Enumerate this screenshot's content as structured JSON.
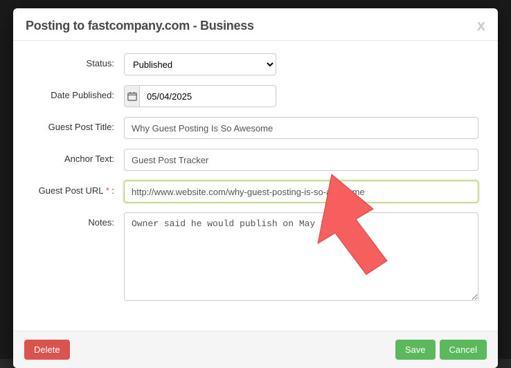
{
  "modal": {
    "title": "Posting to fastcompany.com - Business"
  },
  "form": {
    "labels": {
      "status": "Status:",
      "date": "Date Published:",
      "title": "Guest Post Title:",
      "anchor": "Anchor Text:",
      "url_prefix": "Guest Post URL",
      "url_req": "*",
      "url_suffix": ":",
      "notes": "Notes:"
    },
    "status": {
      "selected": "Published",
      "options": [
        "Published"
      ]
    },
    "date": "05/04/2025",
    "title_value": "Why Guest Posting Is So Awesome",
    "anchor_value": "Guest Post Tracker",
    "url_value": "http://www.website.com/why-guest-posting-is-so-awesome",
    "notes_value": "Owner said he would publish on May 3rd."
  },
  "footer": {
    "delete": "Delete",
    "save": "Save",
    "cancel": "Cancel"
  },
  "colors": {
    "arrow": "#f75f5f",
    "success": "#5cb85c",
    "danger": "#d9534f",
    "focus": "#b0cc60"
  }
}
